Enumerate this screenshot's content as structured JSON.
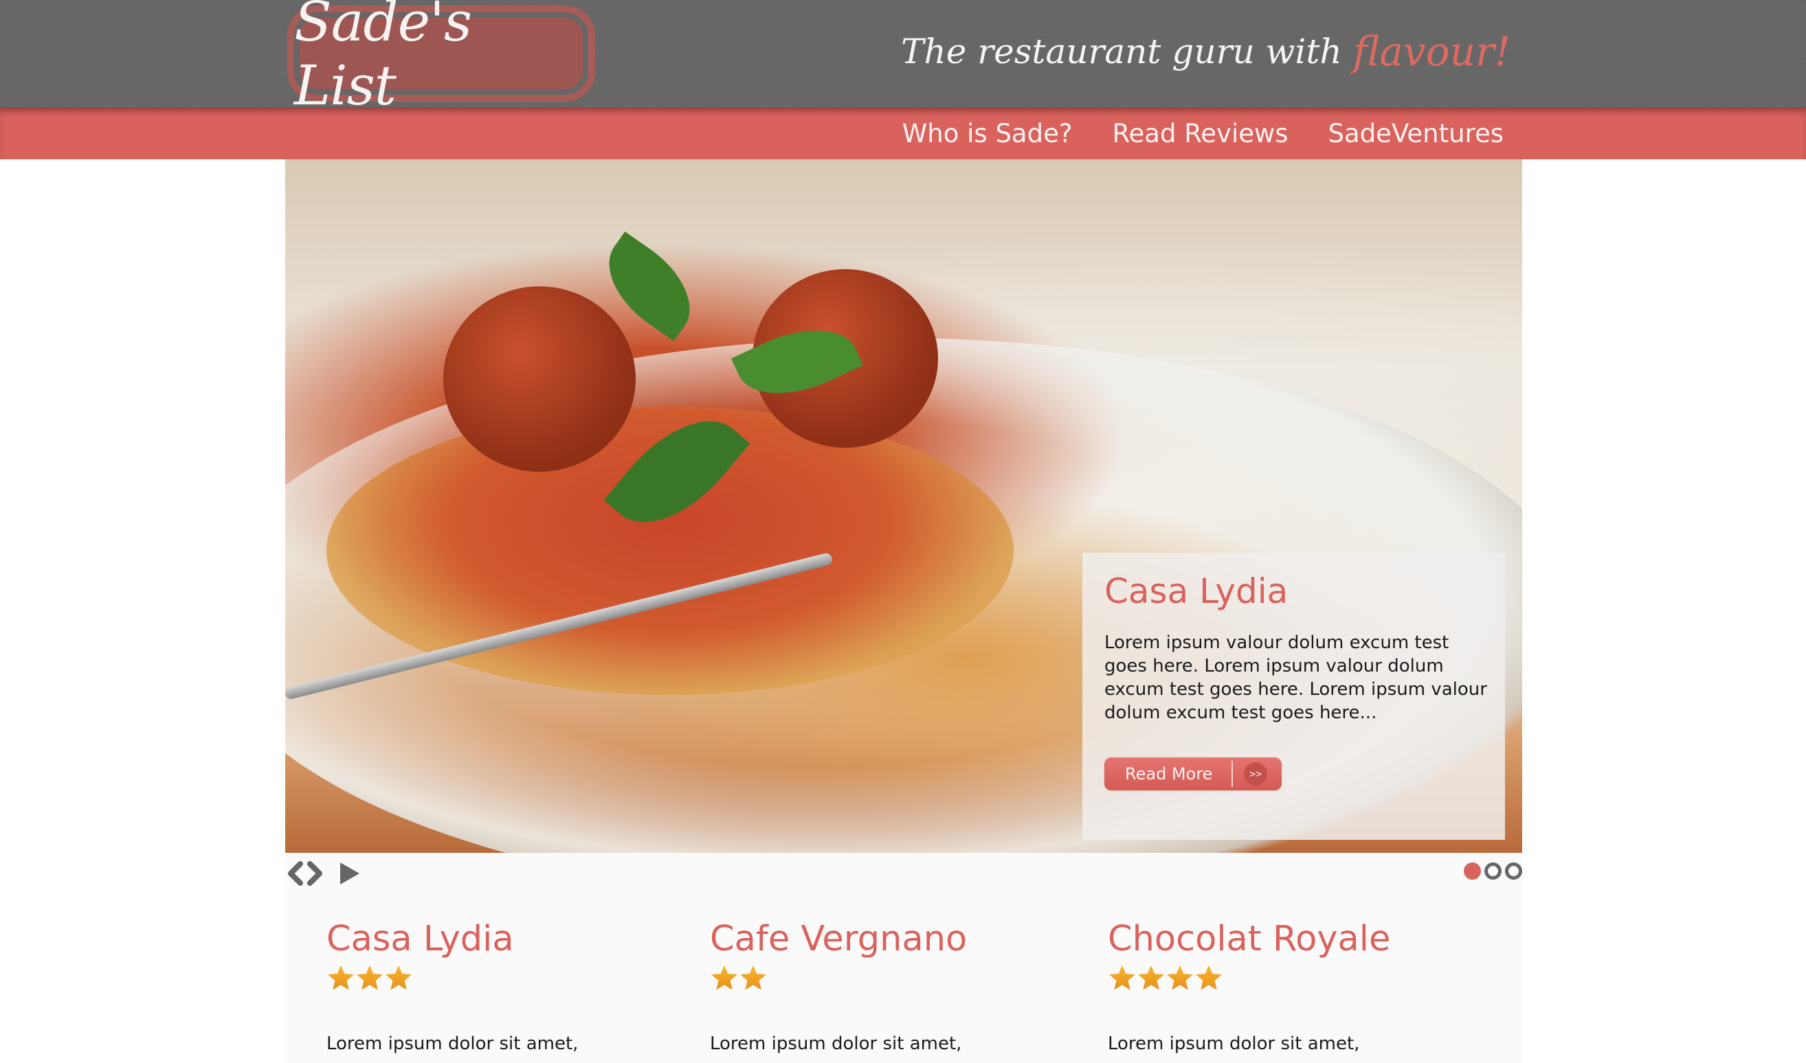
{
  "header": {
    "logo_text": "Sade's List",
    "tagline": "The restaurant guru with",
    "tagline_accent": "flavour!"
  },
  "nav": {
    "items": [
      {
        "label": "Who is Sade?"
      },
      {
        "label": "Read Reviews"
      },
      {
        "label": "SadeVentures"
      }
    ]
  },
  "slider": {
    "image_alt": "Spaghetti and meatballs with basil",
    "overlay": {
      "title": "Casa Lydia",
      "text": "Lorem ipsum valour dolum excum test goes here. Lorem ipsum valour dolum excum test goes here. Lorem ipsum valour dolum excum test goes here...",
      "button_label": "Read More",
      "button_arrow": ">>"
    },
    "controls": {
      "prev_icon": "chevron-left-icon",
      "next_icon": "chevron-right-icon",
      "play_icon": "play-icon"
    },
    "pagination": {
      "total": 3,
      "active": 1
    }
  },
  "cards": [
    {
      "title": "Casa Lydia",
      "rating": 3,
      "excerpt": "Lorem ipsum dolor sit amet,"
    },
    {
      "title": "Cafe Vergnano",
      "rating": 2,
      "excerpt": "Lorem ipsum dolor sit amet,"
    },
    {
      "title": "Chocolat Royale",
      "rating": 4,
      "excerpt": "Lorem ipsum dolor sit amet,"
    }
  ],
  "colors": {
    "brand_red": "#d9625d",
    "header_gray": "#666666",
    "star_gold": "#f2a623",
    "control_gray": "#666666"
  }
}
